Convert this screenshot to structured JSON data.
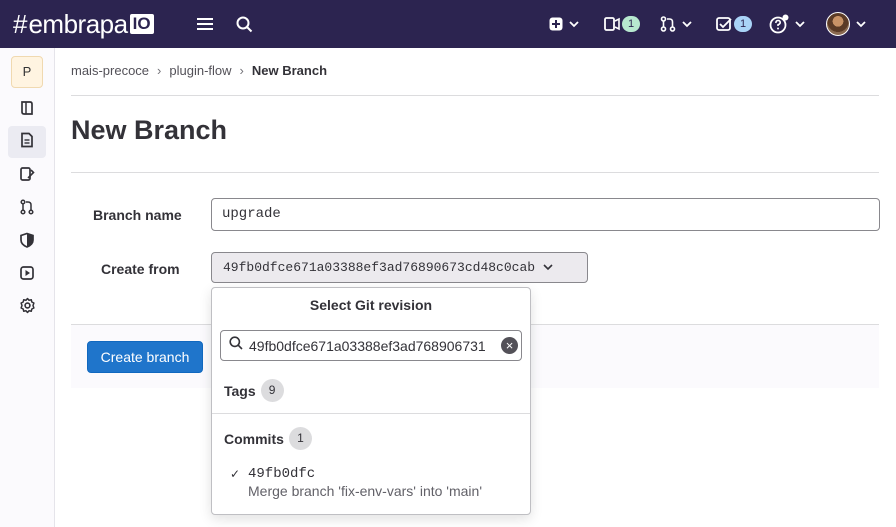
{
  "brand": {
    "hash": "#",
    "name": "embrapa",
    "version": "IO"
  },
  "topbar": {
    "issues_count": "1",
    "todos_count": "1"
  },
  "sidebar": {
    "project_initial": "P",
    "items": [
      {
        "name": "project-overview",
        "icon": "book-icon"
      },
      {
        "name": "repository",
        "icon": "file-icon",
        "active": true
      },
      {
        "name": "issues",
        "icon": "issues-icon"
      },
      {
        "name": "merge-requests",
        "icon": "merge-request-icon"
      },
      {
        "name": "security",
        "icon": "shield-icon"
      },
      {
        "name": "deployments",
        "icon": "deploy-icon"
      },
      {
        "name": "settings",
        "icon": "gear-icon"
      }
    ]
  },
  "breadcrumb": {
    "group": "mais-precoce",
    "project": "plugin-flow",
    "current": "New Branch"
  },
  "page": {
    "title": "New Branch",
    "branch_name_label": "Branch name",
    "branch_name_value": "upgrade",
    "create_from_label": "Create from",
    "create_from_value": "49fb0dfce671a03388ef3ad76890673cd48c0cab",
    "create_button": "Create branch"
  },
  "dropdown": {
    "title": "Select Git revision",
    "search_value": "49fb0dfce671a03388ef3ad768906731",
    "tags_label": "Tags",
    "tags_count": "9",
    "commits_label": "Commits",
    "commits_count": "1",
    "commit": {
      "sha": "49fb0dfc",
      "message": "Merge branch 'fix-env-vars' into 'main'"
    }
  },
  "colors": {
    "topbar": "#2c2450",
    "primary_button": "#1f75cb"
  }
}
